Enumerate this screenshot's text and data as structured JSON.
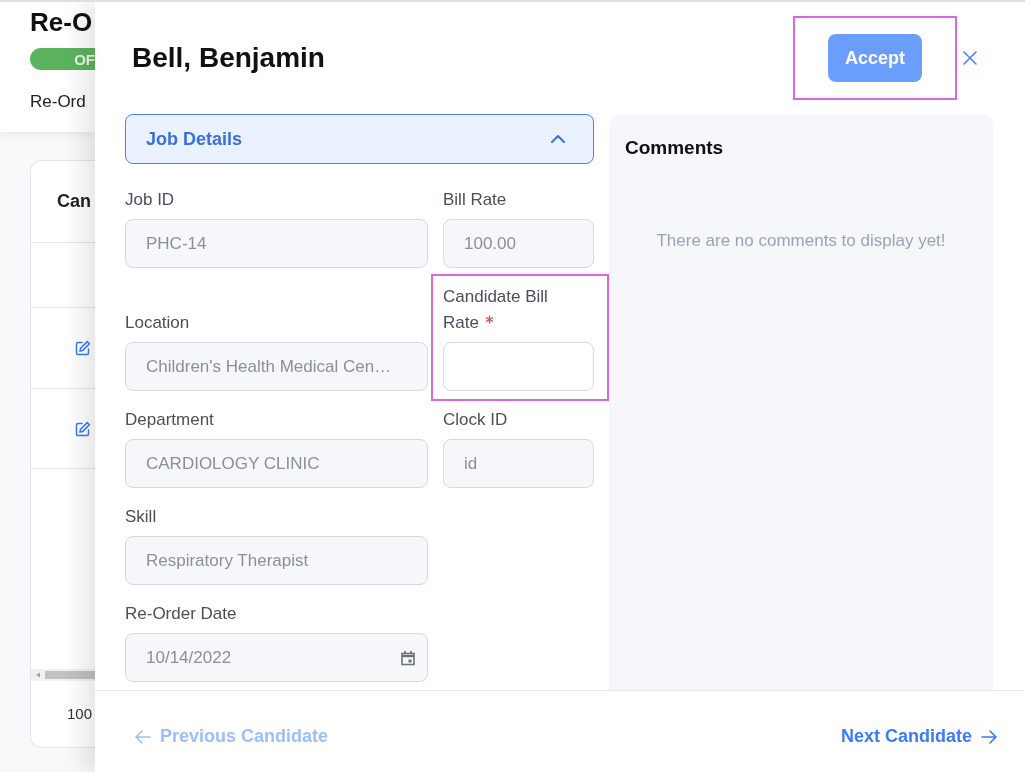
{
  "background_page": {
    "title": "Re-O",
    "status_badge": "OF",
    "subtitle": "Re-Ord",
    "table": {
      "header": "Can",
      "rows": [
        {
          "editable": false
        },
        {
          "editable": true
        },
        {
          "editable": true
        }
      ],
      "footer": "100"
    }
  },
  "drawer": {
    "title": "Bell, Benjamin",
    "accept_button": {
      "label": "Accept",
      "disabled": true,
      "highlighted": true
    },
    "section": {
      "title": "Job Details",
      "expanded": true,
      "rows": [
        {
          "fields": [
            {
              "label": "Job ID",
              "kind": "text",
              "value": "PHC-14",
              "disabled": true,
              "required": false,
              "highlighted": false
            },
            {
              "label": "Bill Rate",
              "kind": "text",
              "value": "100.00",
              "disabled": true,
              "required": false,
              "highlighted": false
            }
          ]
        },
        {
          "fields": [
            {
              "label": "Location",
              "kind": "text",
              "value": "Children's Health Medical Cen…",
              "disabled": true,
              "required": false,
              "highlighted": false
            },
            {
              "label": "Candidate Bill Rate",
              "kind": "text",
              "disabled": false,
              "required": true,
              "highlighted": true
            }
          ]
        },
        {
          "fields": [
            {
              "label": "Department",
              "kind": "text",
              "value": "CARDIOLOGY CLINIC",
              "disabled": true,
              "required": false,
              "highlighted": false
            },
            {
              "label": "Clock ID",
              "kind": "text",
              "value": "id",
              "disabled": true,
              "required": false,
              "highlighted": false
            }
          ]
        },
        {
          "fields": [
            {
              "label": "Skill",
              "kind": "text",
              "value": "Respiratory Therapist",
              "disabled": true,
              "required": false,
              "highlighted": false
            }
          ]
        },
        {
          "fields": [
            {
              "label": "Re-Order Date",
              "kind": "date",
              "value": "10/14/2022",
              "disabled": true,
              "required": false,
              "highlighted": false
            }
          ]
        }
      ]
    },
    "comments": {
      "title": "Comments",
      "empty_message": "There are no comments to display yet!"
    },
    "footer": {
      "previous": {
        "label": "Previous Candidate",
        "disabled": true
      },
      "next": {
        "label": "Next Candidate",
        "disabled": false
      }
    }
  }
}
